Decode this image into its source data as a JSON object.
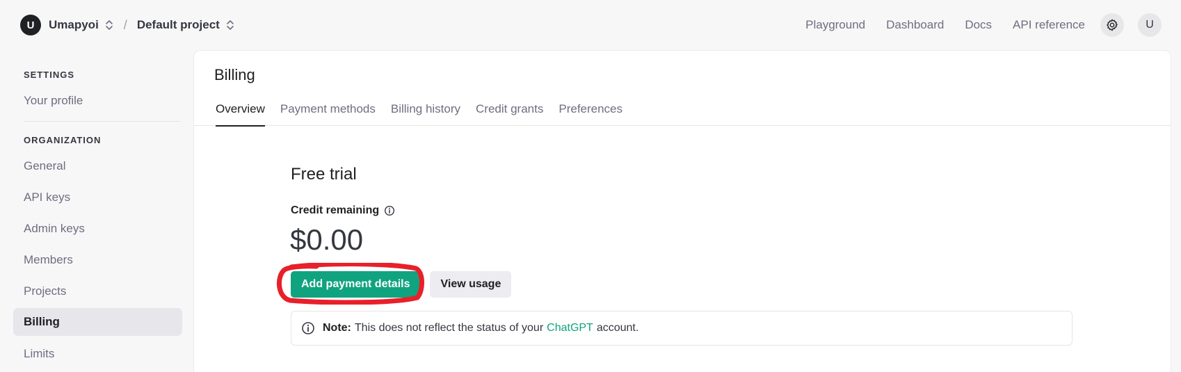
{
  "header": {
    "org_initial": "U",
    "org_name": "Umapyoi",
    "separator": "/",
    "project_name": "Default project",
    "nav": [
      "Playground",
      "Dashboard",
      "Docs",
      "API reference"
    ],
    "user_initial": "U"
  },
  "sidebar": {
    "settings_heading": "SETTINGS",
    "profile": "Your profile",
    "organization_heading": "ORGANIZATION",
    "items": [
      "General",
      "API keys",
      "Admin keys",
      "Members",
      "Projects",
      "Billing",
      "Limits"
    ],
    "active_item": "Billing"
  },
  "billing": {
    "title": "Billing",
    "tabs": [
      "Overview",
      "Payment methods",
      "Billing history",
      "Credit grants",
      "Preferences"
    ],
    "active_tab": "Overview",
    "plan": "Free trial",
    "credit_label": "Credit remaining",
    "credit_amount": "$0.00",
    "primary_button": "Add payment details",
    "secondary_button": "View usage",
    "note_label": "Note:",
    "note_text_before": "This does not reflect the status of your",
    "note_link": "ChatGPT",
    "note_text_after": "account."
  },
  "colors": {
    "accent": "#10a37f",
    "annotation": "#e8202a"
  },
  "icons": {
    "settings": "gear-icon",
    "info": "info-icon",
    "switcher": "chevron-up-down-icon"
  }
}
